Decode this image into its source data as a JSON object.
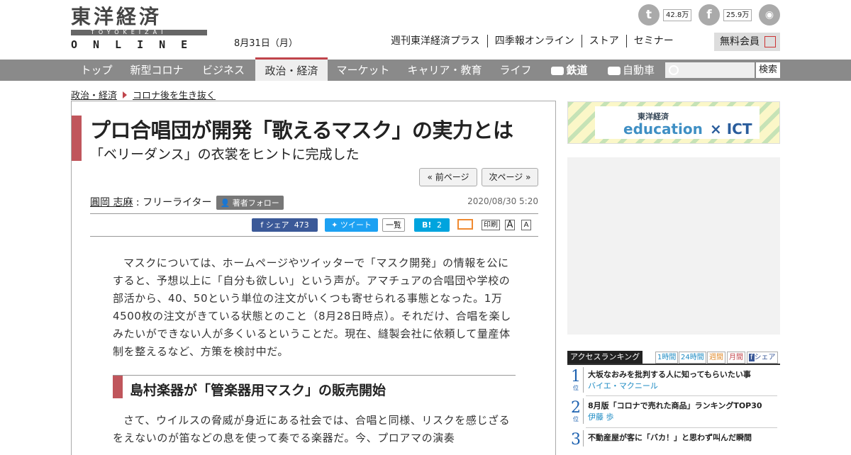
{
  "site": {
    "logo_kanji": "東洋経済",
    "logo_romaji": "TOYOKEIZAI",
    "logo_online": "ONLINE",
    "date": "8月31日（月）",
    "top_links": [
      "週刊東洋経済プラス",
      "四季報オンライン",
      "ストア",
      "セミナー"
    ],
    "free_member": "無料会員",
    "social": [
      {
        "icon": "twitter-icon",
        "glyph": "t",
        "count": "42.8万"
      },
      {
        "icon": "facebook-icon",
        "glyph": "f",
        "count": "25.9万"
      },
      {
        "icon": "rss-icon",
        "glyph": "◉",
        "count": ""
      }
    ]
  },
  "nav": {
    "items": [
      "トップ",
      "新型コロナ",
      "ビジネス",
      "政治・経済",
      "マーケット",
      "キャリア・教育",
      "ライフ",
      "鉄道",
      "自動車"
    ],
    "active": "政治・経済",
    "search_button": "検索"
  },
  "breadcrumb": [
    "政治・経済",
    "コロナ後を生き抜く"
  ],
  "article": {
    "title": "プロ合唱団が開発「歌えるマスク」の実力とは",
    "subtitle": "「ベリーダンス」の衣裳をヒントに完成した",
    "prev_page": "« 前ページ",
    "next_page": "次ページ »",
    "author_name": "圓岡 志麻",
    "author_role": " : フリーライター",
    "follow": "著者フォロー",
    "published": "2020/08/30 5:20",
    "share": {
      "fb_label": "シェア",
      "fb_count": "473",
      "tweet": "ツイート",
      "list": "一覧",
      "hatena": "B!",
      "hatena_count": "2",
      "print": "印刷",
      "font_large": "A",
      "font_small": "A"
    },
    "paragraph1": "マスクについては、ホームページやツイッターで「マスク開発」の情報を公にすると、予想以上に「自分も欲しい」という声が。アマチュアの合唱団や学校の部活から、40、50という単位の注文がいくつも寄せられる事態となった。1万4500枚の注文がきている状態とのこと（8月28日時点）。それだけ、合唱を楽しみたいができない人が多くいるということだ。現在、縫製会社に依頼して量産体制を整えるなど、方策を検討中だ。",
    "heading2": "島村楽器が「管楽器用マスク」の販売開始",
    "paragraph2": "さて、ウイルスの脅威が身近にある社会では、合唱と同様、リスクを感じざるをえないのが笛などの息を使って奏でる楽器だ。今、プロアマの演奏"
  },
  "sidebar": {
    "banner_small": "東洋経済",
    "banner_edu": "education",
    "banner_ict": "× ICT",
    "ranking_title": "アクセスランキング",
    "ranking_tabs": [
      "1時間",
      "24時間",
      "週間",
      "月間",
      "シェア"
    ],
    "rank_suffix": "位",
    "ranking": [
      {
        "rank": "1",
        "title": "大坂なおみを批判する人に知ってもらいたい事",
        "author": "バイエ・マクニール"
      },
      {
        "rank": "2",
        "title": "8月版「コロナで売れた商品」ランキングTOP30",
        "author": "伊藤 歩"
      },
      {
        "rank": "3",
        "title": "不動産屋が客に「バカ！」と思わず叫んだ瞬間",
        "author": ""
      }
    ]
  },
  "colors": {
    "accent": "#c0565c",
    "nav_bg": "#8a8a8a",
    "rank_blue": "#1e62b0"
  }
}
